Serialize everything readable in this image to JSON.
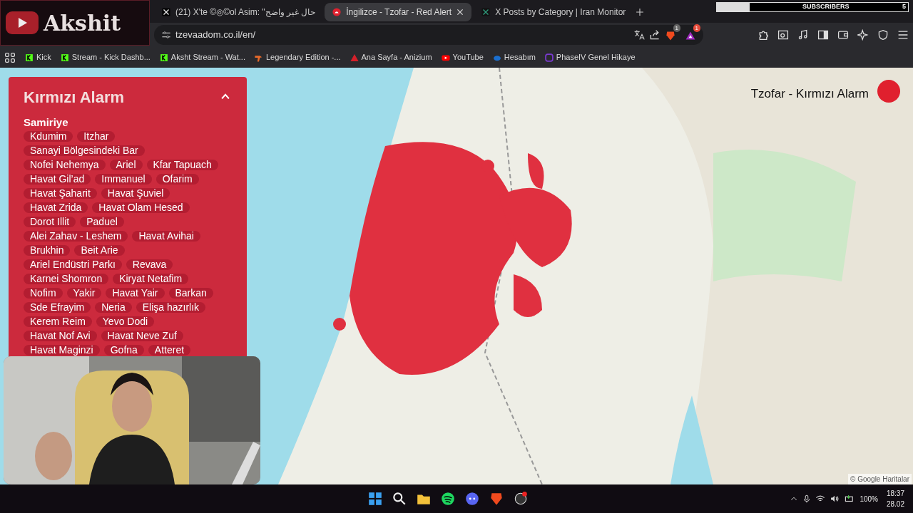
{
  "stream_overlay": {
    "logo": "Akshit",
    "subscribers_label": "SUBSCRIBERS",
    "subscribers_count": "5",
    "level": 0.17
  },
  "tabs": [
    {
      "title": "(21) X'te ©◎©ol Asim: \"حال غير واضح",
      "selected": false
    },
    {
      "title": "İngilizce - Tzofar - Red Alert",
      "selected": true
    },
    {
      "title": "X Posts by Category | Iran Monitor",
      "selected": false
    }
  ],
  "address": "tzevaadom.co.il/en/",
  "extension_badges": [
    "1",
    "1"
  ],
  "bookmarks": [
    {
      "title": "Kick",
      "kind": "kick"
    },
    {
      "title": "Stream - Kick Dashb...",
      "kind": "kick"
    },
    {
      "title": "Aksht Stream - Wat...",
      "kind": "kick"
    },
    {
      "title": "Legendary Edition -...",
      "kind": "legend"
    },
    {
      "title": "Ana Sayfa - Anizium",
      "kind": "anizium"
    },
    {
      "title": "YouTube",
      "kind": "youtube"
    },
    {
      "title": "Hesabım",
      "kind": "account"
    },
    {
      "title": "PhaseIV Genel Hikaye",
      "kind": "phase"
    }
  ],
  "alert_panel": {
    "title": "Kırmızı Alarm",
    "region": "Samiriye",
    "places": [
      "Kdumim",
      "Itzhar",
      "Sanayi Bölgesindeki Bar",
      "Nofei Nehemya",
      "Ariel",
      "Kfar Tapuach",
      "Havat Gil’ad",
      "Immanuel",
      "Ofarim",
      "Havat Şaharit",
      "Havat Şuviel",
      "Havat Zrida",
      "Havat Olam Hesed",
      "Dorot Illit",
      "Paduel",
      "Alei Zahav - Leshem",
      "Havat Avihai",
      "Brukhin",
      "Beit Arie",
      "Ariel Endüstri Parkı",
      "Revava",
      "Karnei Shomron",
      "Kiryat Netafim",
      "Nofim",
      "Yakir",
      "Havat Yair",
      "Barkan",
      "Sde Efrayim",
      "Neria",
      "Elişa hazırlık",
      "Kerem Reim",
      "Yevo Dodi",
      "Havat Nof Avi",
      "Havat Neve Zuf",
      "Havat Maginzi",
      "Gofna",
      "Atteret"
    ]
  },
  "map": {
    "brand": "Tzofar - Kırmızı Alarm",
    "attribution": "© Google Haritalar"
  },
  "taskbar": {
    "battery": "100%",
    "time": "18:37",
    "date": "28.02"
  }
}
